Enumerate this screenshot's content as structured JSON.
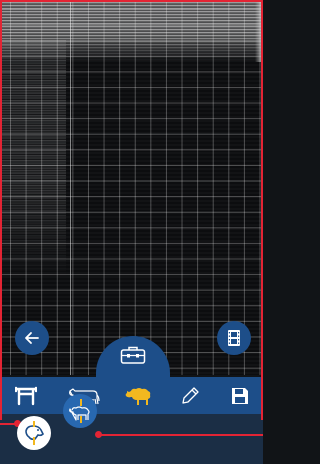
{
  "colors": {
    "frame": "#e32434",
    "panel": "#1d4e89",
    "panel_dark": "#1b2e45",
    "accent": "#f2b81f",
    "icon": "#ffffff"
  },
  "overlay": {
    "back_icon": "arrow-left-icon",
    "film_icon": "film-strip-icon",
    "center_icon": "toolbox-icon"
  },
  "toolbar": {
    "tools": [
      {
        "icon": "gate-icon",
        "active": false
      },
      {
        "icon": "cow-icon",
        "active": false
      },
      {
        "icon": "sheep-icon",
        "active": true
      },
      {
        "icon": "pencil-icon",
        "active": false
      },
      {
        "icon": "save-icon",
        "active": false
      }
    ]
  },
  "probe_modes": [
    {
      "icon": "sheep-head-probe-icon",
      "active": true
    },
    {
      "icon": "sheep-side-probe-icon",
      "active": false
    }
  ]
}
